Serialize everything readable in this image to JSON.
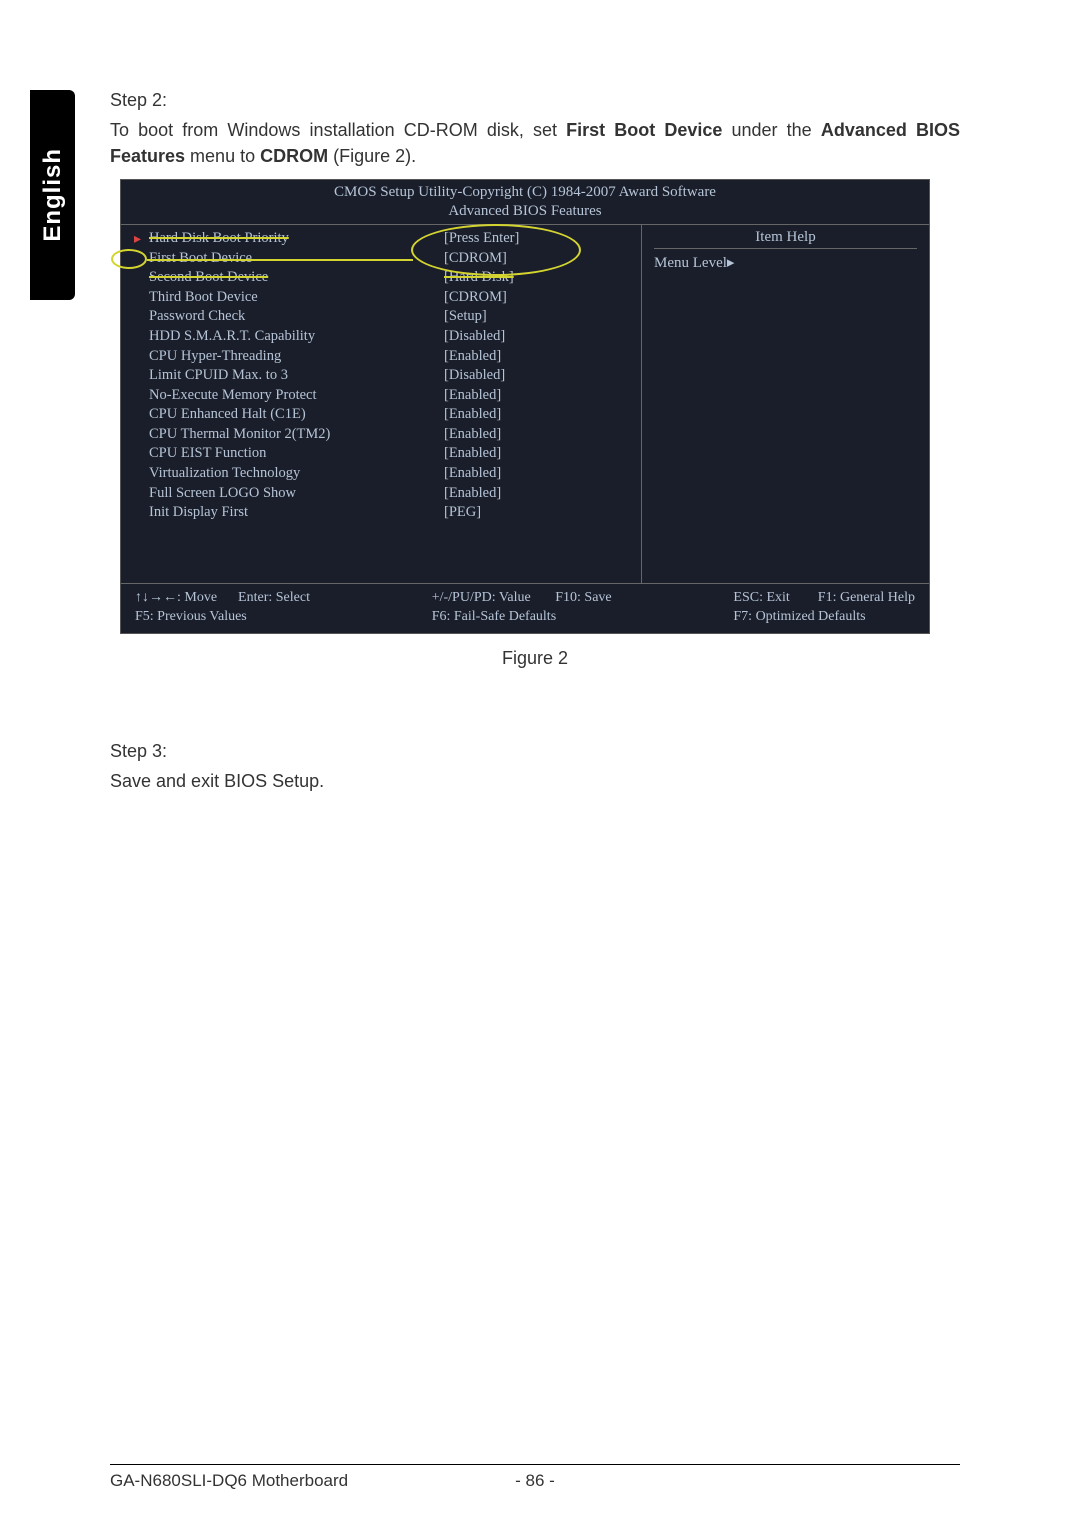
{
  "sidebar": {
    "label": "English"
  },
  "step2": {
    "heading": "Step 2:",
    "text_before_fbd": "To boot from Windows installation CD-ROM disk, set ",
    "first_boot_device": "First Boot Device",
    "under_the": " under the ",
    "advanced_bios_features": "Advanced BIOS Features",
    "menu_to": " menu to ",
    "cdrom": "CDROM",
    "figure_ref": " (Figure 2)."
  },
  "bios": {
    "header1": "CMOS Setup Utility-Copyright (C) 1984-2007 Award Software",
    "header2": "Advanced BIOS Features",
    "help_title": "Item Help",
    "menu_level": "Menu Level",
    "rows": [
      {
        "label": "Hard Disk Boot Priority",
        "value": "[Press Enter]"
      },
      {
        "label": "First Boot Device",
        "value": "[CDROM]"
      },
      {
        "label": "Second Boot Device",
        "value": "[Hard Disk]"
      },
      {
        "label": "Third Boot Device",
        "value": "[CDROM]"
      },
      {
        "label": "Password Check",
        "value": "[Setup]"
      },
      {
        "label": "HDD S.M.A.R.T. Capability",
        "value": "[Disabled]"
      },
      {
        "label": "CPU Hyper-Threading",
        "value": "[Enabled]"
      },
      {
        "label": "Limit CPUID Max. to 3",
        "value": "[Disabled]"
      },
      {
        "label": "No-Execute Memory Protect",
        "value": "[Enabled]"
      },
      {
        "label": "CPU Enhanced Halt (C1E)",
        "value": "[Enabled]"
      },
      {
        "label": "CPU Thermal Monitor 2(TM2)",
        "value": "[Enabled]"
      },
      {
        "label": "CPU EIST Function",
        "value": "[Enabled]"
      },
      {
        "label": "Virtualization Technology",
        "value": "[Enabled]"
      },
      {
        "label": "Full Screen LOGO Show",
        "value": "[Enabled]"
      },
      {
        "label": "Init Display First",
        "value": "[PEG]"
      }
    ],
    "footer": {
      "c1l1": "↑↓→←: Move      Enter: Select",
      "c1l2": "F5: Previous Values",
      "c2l1": "+/-/PU/PD: Value       F10: Save",
      "c2l2": "F6: Fail-Safe Defaults",
      "c3l1": "ESC: Exit        F1: General Help",
      "c3l2": "F7: Optimized Defaults"
    }
  },
  "figure_caption": "Figure 2",
  "step3": {
    "heading": "Step 3:",
    "text": "Save and exit BIOS Setup."
  },
  "footer": {
    "left": "GA-N680SLI-DQ6 Motherboard",
    "center": "- 86 -"
  }
}
